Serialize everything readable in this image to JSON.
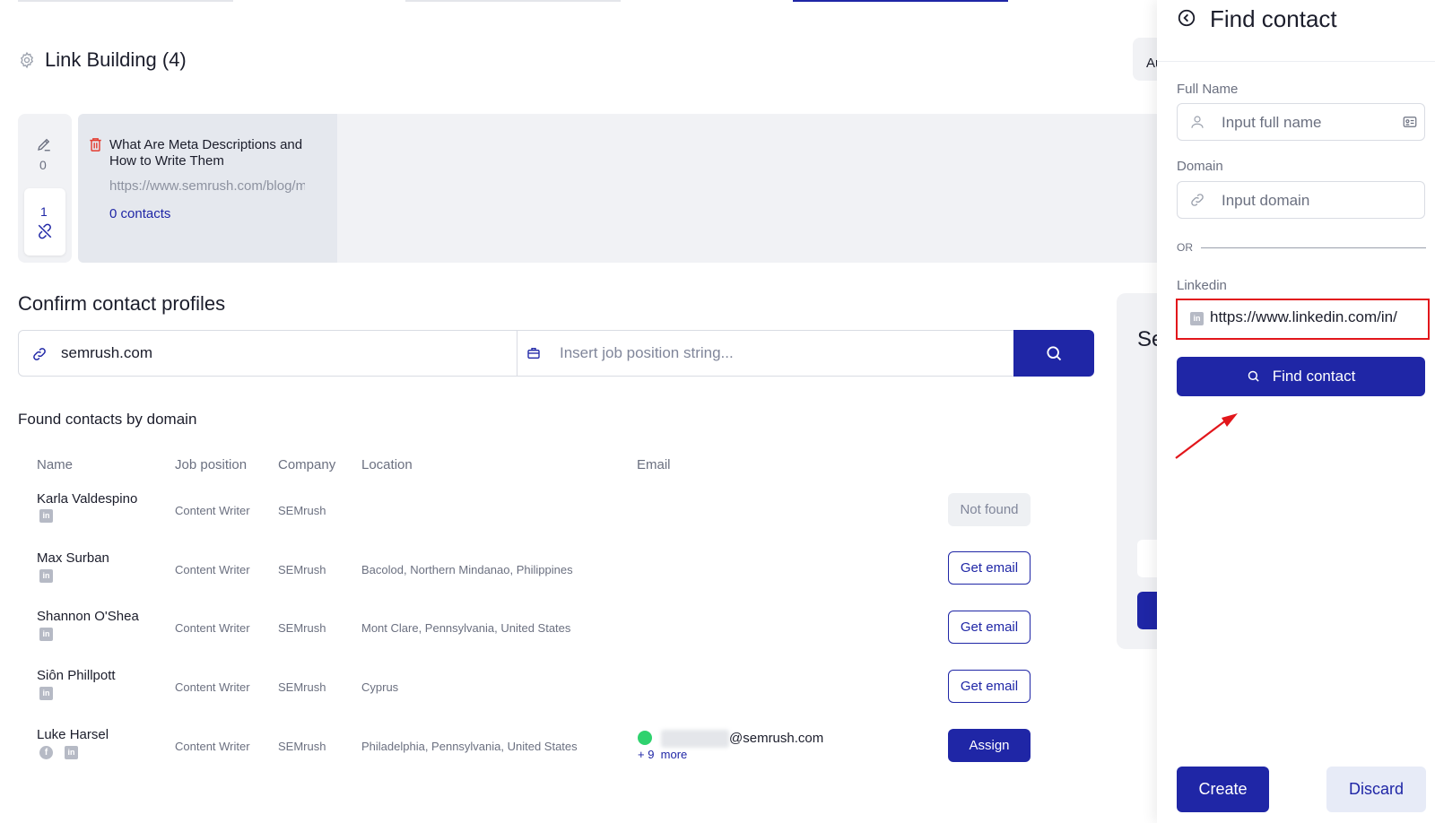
{
  "page": {
    "title": "Link Building (4)",
    "top_right_button": "Au"
  },
  "link_building": {
    "pending_count": "0",
    "unlinked_count": "1",
    "article": {
      "title": "What Are Meta Descriptions and How to Write Them",
      "url": "https://www.semrush.com/blog/meta-descriptions/",
      "contacts": "0 contacts"
    }
  },
  "confirm": {
    "title": "Confirm contact profiles",
    "domain_value": "semrush.com",
    "job_placeholder": "Insert job position string...",
    "found_title": "Found contacts by domain",
    "columns": {
      "name": "Name",
      "job": "Job position",
      "company": "Company",
      "location": "Location",
      "email": "Email"
    },
    "rows": [
      {
        "name": "Karla Valdespino",
        "job": "Content Writer",
        "company": "SEMrush",
        "location": "",
        "email": "",
        "action": "Not found"
      },
      {
        "name": "Max Surban",
        "job": "Content Writer",
        "company": "SEMrush",
        "location": "Bacolod, Northern Mindanao, Philippines",
        "email": "",
        "action": "Get email"
      },
      {
        "name": "Shannon O'Shea",
        "job": "Content Writer",
        "company": "SEMrush",
        "location": "Mont Clare, Pennsylvania, United States",
        "email": "",
        "action": "Get email"
      },
      {
        "name": "Siôn Phillpott",
        "job": "Content Writer",
        "company": "SEMrush",
        "location": "Cyprus",
        "email": "",
        "action": "Get email"
      },
      {
        "name": "Luke Harsel",
        "job": "Content Writer",
        "company": "SEMrush",
        "location": "Philadelphia, Pennsylvania, United States",
        "email": "@semrush.com",
        "email_more_count": "+ 9",
        "email_more": "more",
        "action": "Assign"
      }
    ]
  },
  "background_card": {
    "heading": "Se"
  },
  "panel": {
    "title": "Find contact",
    "full_name_label": "Full Name",
    "full_name_placeholder": "Input full name",
    "domain_label": "Domain",
    "domain_placeholder": "Input domain",
    "or_label": "OR",
    "linkedin_label": "Linkedin",
    "linkedin_value": "https://www.linkedin.com/in/",
    "find_button": "Find contact",
    "create_button": "Create",
    "discard_button": "Discard"
  },
  "colors": {
    "primary": "#1f26a6",
    "highlight": "#e2161b",
    "status_green": "#2fd26e",
    "danger_icon": "#e33b2f"
  }
}
